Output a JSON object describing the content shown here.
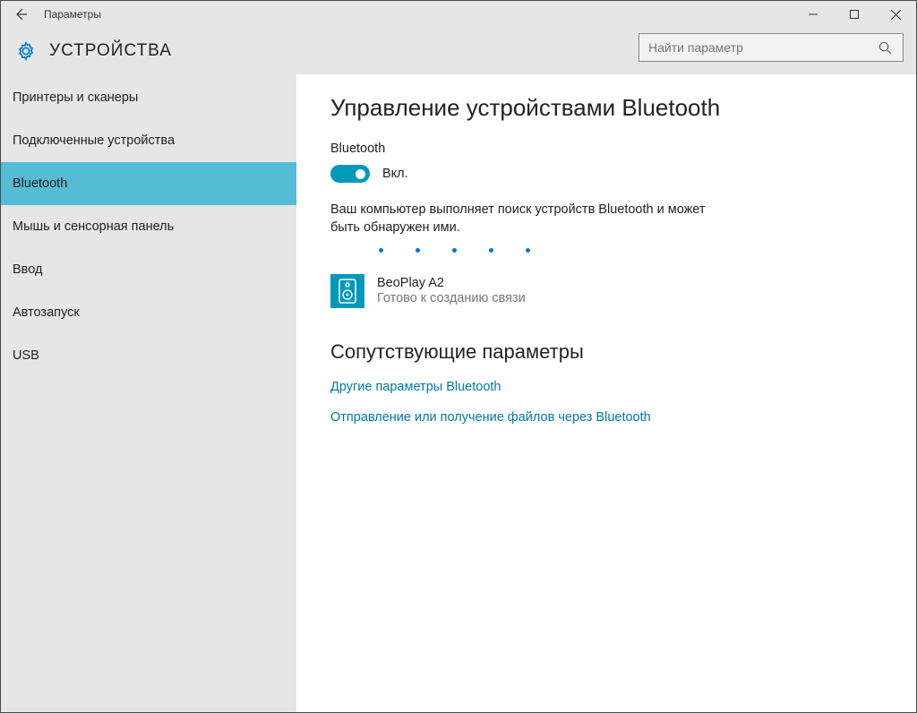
{
  "titlebar": {
    "title": "Параметры"
  },
  "header": {
    "section": "УСТРОЙСТВА",
    "search_placeholder": "Найти параметр"
  },
  "sidebar": {
    "items": [
      {
        "label": "Принтеры и сканеры",
        "selected": false
      },
      {
        "label": "Подключенные устройства",
        "selected": false
      },
      {
        "label": "Bluetooth",
        "selected": true
      },
      {
        "label": "Мышь и сенсорная панель",
        "selected": false
      },
      {
        "label": "Ввод",
        "selected": false
      },
      {
        "label": "Автозапуск",
        "selected": false
      },
      {
        "label": "USB",
        "selected": false
      }
    ]
  },
  "main": {
    "title": "Управление устройствами Bluetooth",
    "bluetooth_label": "Bluetooth",
    "toggle_state_label": "Вкл.",
    "status_text": "Ваш компьютер выполняет поиск устройств Bluetooth и может быть обнаружен ими.",
    "device": {
      "name": "BeoPlay A2",
      "status": "Готово к созданию связи"
    },
    "related_title": "Сопутствующие параметры",
    "links": [
      "Другие параметры Bluetooth",
      "Отправление или получение файлов через Bluetooth"
    ]
  }
}
